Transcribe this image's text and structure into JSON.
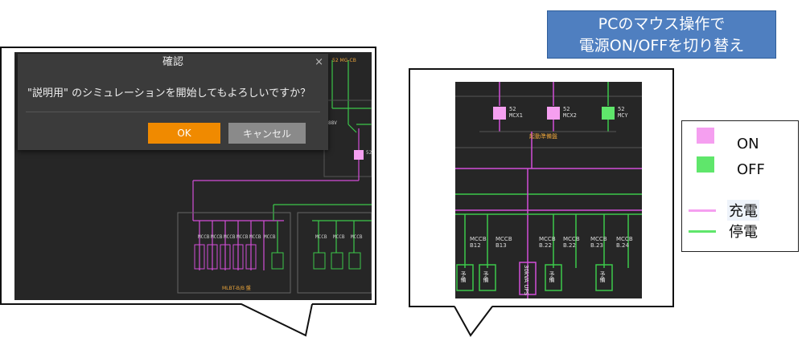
{
  "dialog": {
    "title": "確認",
    "close_glyph": "×",
    "message": "\"説明用\" のシミュレーションを開始してもよろしいですか？",
    "ok_label": "OK",
    "cancel_label": "キャンセル"
  },
  "title_box": {
    "line1": "PCのマウス操作で",
    "line2": "電源ON/OFFを切り替え"
  },
  "legend": {
    "on_label": "ON",
    "off_label": "OFF",
    "charged_label": "充電",
    "dead_label": "停電",
    "on_color": "#f59ff0",
    "off_color": "#5fe66b"
  },
  "right_panel": {
    "switches": [
      {
        "name": "52",
        "id": "MCX1"
      },
      {
        "name": "52",
        "id": "MCX2"
      },
      {
        "name": "52",
        "id": "MCY"
      }
    ],
    "bus_label": "起動準備盤",
    "breakers": [
      {
        "line1": "MCCB",
        "line2": "B12"
      },
      {
        "line1": "MCCB",
        "line2": "B13"
      },
      {
        "line1": "MCCB",
        "line2": "B.22"
      },
      {
        "line1": "MCCB",
        "line2": "B.22"
      },
      {
        "line1": "MCCB",
        "line2": "B.23"
      },
      {
        "line1": "MCCB",
        "line2": "B.24"
      }
    ],
    "load_label": "予備",
    "ups_label": "30kVA UPS"
  },
  "colors": {
    "charged_line": "#d24ed8",
    "dead_line": "#3cc84a",
    "panel_bg": "#262626",
    "title_box_bg": "#4f7fc0",
    "ok_button": "#f08a00"
  }
}
